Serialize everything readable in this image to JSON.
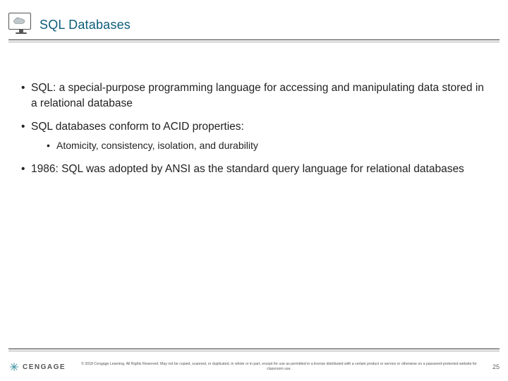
{
  "header": {
    "title": "SQL Databases",
    "icon": "cloud-monitor-icon"
  },
  "bullets": [
    {
      "text": "SQL: a special-purpose programming language for accessing and manipulating data stored in a relational database",
      "sub": []
    },
    {
      "text": "SQL databases conform to ACID properties:",
      "sub": [
        "Atomicity, consistency, isolation, and durability"
      ]
    },
    {
      "text": "1986: SQL was adopted by ANSI as the standard query language for relational databases",
      "sub": []
    }
  ],
  "footer": {
    "logo_text": "CENGAGE",
    "copyright": "© 2018 Cengage Learning. All Rights Reserved. May not be copied, scanned, or duplicated, in whole or in part, except for use as permitted in a license distributed with a certain product or service or otherwise on a password-protected website for classroom use.",
    "page_number": "25"
  }
}
